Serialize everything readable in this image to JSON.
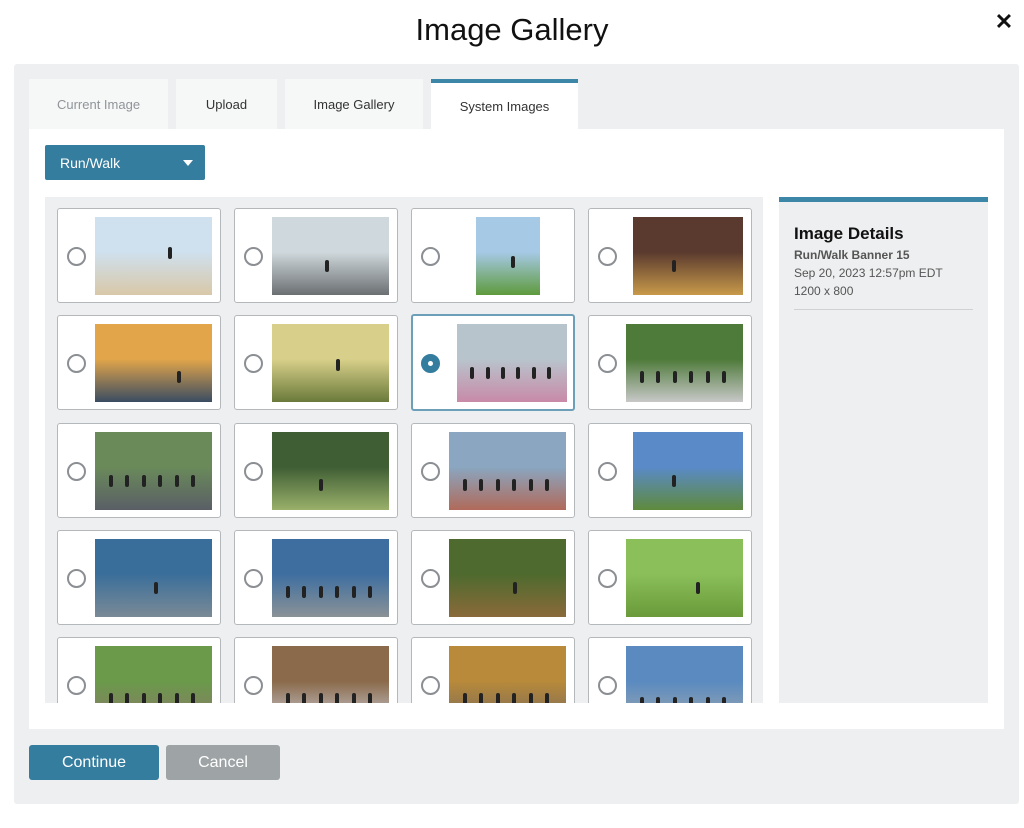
{
  "modal": {
    "title": "Image Gallery",
    "close_label": "✕"
  },
  "tabs": [
    {
      "label": "Current Image",
      "state": "disabled"
    },
    {
      "label": "Upload",
      "state": "normal"
    },
    {
      "label": "Image Gallery",
      "state": "normal"
    },
    {
      "label": "System Images",
      "state": "active"
    }
  ],
  "category_select": {
    "value": "Run/Walk"
  },
  "gallery": {
    "selected_index": 6,
    "items": [
      {
        "kind": "mountain-runner",
        "colors": [
          "#cfe0ee",
          "#d8c8a8"
        ]
      },
      {
        "kind": "tunnel-runners",
        "colors": [
          "#cfd8dc",
          "#6b6f72"
        ]
      },
      {
        "kind": "park-runner",
        "colors": [
          "#a6c9e6",
          "#5e9a3c"
        ]
      },
      {
        "kind": "forest-runner",
        "colors": [
          "#5a3a2e",
          "#c89a4a"
        ]
      },
      {
        "kind": "beach-sunset",
        "colors": [
          "#e2a54a",
          "#3a4c62"
        ]
      },
      {
        "kind": "woman-woods",
        "colors": [
          "#d8d08a",
          "#6a7a3a"
        ]
      },
      {
        "kind": "street-race",
        "colors": [
          "#b8c4cc",
          "#c88aa8"
        ]
      },
      {
        "kind": "finish-crowd",
        "colors": [
          "#4e7a3a",
          "#c8c8c8"
        ]
      },
      {
        "kind": "crowd-start",
        "colors": [
          "#6a8a5a",
          "#5a5f66"
        ]
      },
      {
        "kind": "forest-path",
        "colors": [
          "#3f5e34",
          "#9ab06a"
        ]
      },
      {
        "kind": "city-race",
        "colors": [
          "#8aa6c0",
          "#b06a5a"
        ]
      },
      {
        "kind": "alps-trail",
        "colors": [
          "#5a8ac8",
          "#5e8a3c"
        ]
      },
      {
        "kind": "photographer",
        "colors": [
          "#3a6e9a",
          "#7a8a96"
        ]
      },
      {
        "kind": "start-finish",
        "colors": [
          "#3e6ea0",
          "#8a9296"
        ]
      },
      {
        "kind": "trail-woods",
        "colors": [
          "#4e6a2e",
          "#8a6a3a"
        ]
      },
      {
        "kind": "flags-field",
        "colors": [
          "#8abf5a",
          "#6a9a3a"
        ]
      },
      {
        "kind": "crowd-park",
        "colors": [
          "#6a9a4a",
          "#8a7a6a"
        ]
      },
      {
        "kind": "crowd-autumn",
        "colors": [
          "#8a6a4a",
          "#c8c8d0"
        ]
      },
      {
        "kind": "crowd-trees",
        "colors": [
          "#b88a3a",
          "#7a6a5a"
        ]
      },
      {
        "kind": "bridge-crowd",
        "colors": [
          "#5a8ac0",
          "#9aa6b0"
        ]
      }
    ]
  },
  "details": {
    "heading": "Image Details",
    "name": "Run/Walk Banner 15",
    "date": "Sep 20, 2023 12:57pm EDT",
    "size": "1200 x 800"
  },
  "actions": {
    "continue_label": "Continue",
    "cancel_label": "Cancel"
  }
}
